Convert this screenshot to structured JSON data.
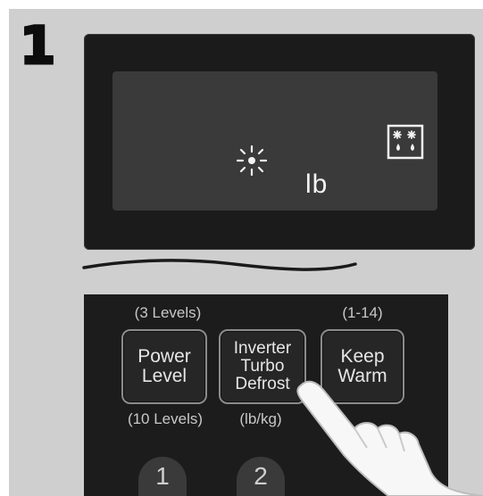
{
  "step": {
    "number": "1"
  },
  "display": {
    "unit": "lb",
    "icons": [
      "sun-icon",
      "defrost-icon"
    ]
  },
  "controls": {
    "top_captions": {
      "power": "(3 Levels)",
      "keep_warm": "(1-14)"
    },
    "bottom_captions": {
      "power": "(10 Levels)",
      "defrost": "(lb/kg)"
    },
    "buttons": [
      {
        "line1": "Power",
        "line2": "Level",
        "line3": ""
      },
      {
        "line1": "Inverter",
        "line2": "Turbo",
        "line3": "Defrost"
      },
      {
        "line1": "Keep",
        "line2": "Warm",
        "line3": ""
      }
    ],
    "number_keys": [
      "1",
      "2"
    ]
  },
  "colors": {
    "panel": "#1c1c1c",
    "screen": "#3a3a3a",
    "background": "#cfcfcf"
  }
}
